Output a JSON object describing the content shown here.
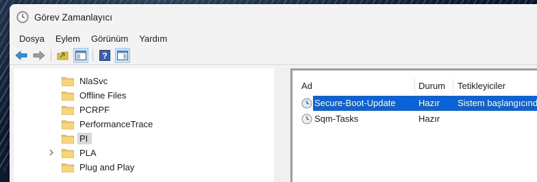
{
  "window": {
    "title": "Görev Zamanlayıcı",
    "icon": "clock-icon"
  },
  "menu": [
    "Dosya",
    "Eylem",
    "Görünüm",
    "Yardım"
  ],
  "toolbar": {
    "buttons": [
      "back-arrow-icon",
      "forward-arrow-icon",
      "up-folder-icon",
      "show-tree-icon",
      "help-icon",
      "show-action-pane-icon"
    ]
  },
  "tree": {
    "items": [
      {
        "label": "NlaSvc"
      },
      {
        "label": "Offline Files"
      },
      {
        "label": "PCRPF"
      },
      {
        "label": "PerformanceTrace"
      },
      {
        "label": "PI",
        "selected": true
      },
      {
        "label": "PLA",
        "expandable": true
      },
      {
        "label": "Plug and Play"
      }
    ]
  },
  "task_list": {
    "columns": [
      "Ad",
      "Durum",
      "Tetikleyiciler"
    ],
    "rows": [
      {
        "name": "Secure-Boot-Update",
        "status": "Hazır",
        "trigger": "Sistem başlangıcınd",
        "selected": true
      },
      {
        "name": "Sqm-Tasks",
        "status": "Hazır",
        "trigger": ""
      }
    ]
  },
  "colors": {
    "selection": "#0a64d8",
    "folder": "#f3c558"
  }
}
